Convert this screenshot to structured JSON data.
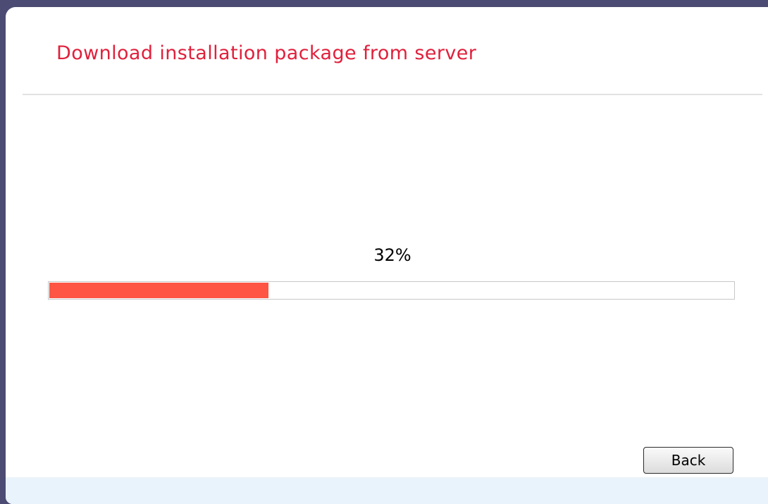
{
  "dialog": {
    "title": "Download installation package from server"
  },
  "progress": {
    "label": "32%",
    "value": 0.32,
    "fill_color": "#ff5544",
    "track_color": "#ffffff"
  },
  "buttons": {
    "back_label": "Back"
  },
  "colors": {
    "title": "#e0203c",
    "frame": "#4b4b73",
    "footer": "#e9f3fb"
  }
}
